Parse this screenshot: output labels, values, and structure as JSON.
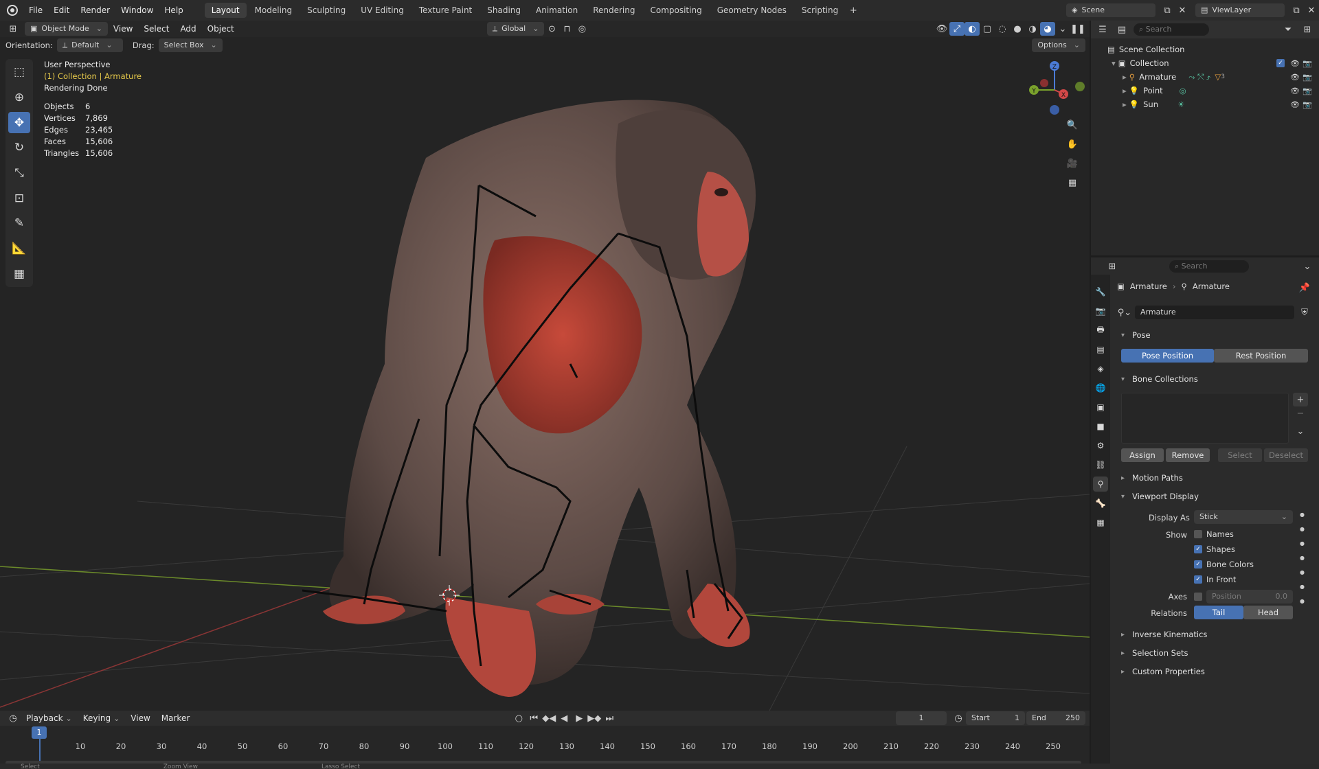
{
  "topbar": {
    "menus": [
      "File",
      "Edit",
      "Render",
      "Window",
      "Help"
    ],
    "workspaces": [
      "Layout",
      "Modeling",
      "Sculpting",
      "UV Editing",
      "Texture Paint",
      "Shading",
      "Animation",
      "Rendering",
      "Compositing",
      "Geometry Nodes",
      "Scripting"
    ],
    "active_workspace": "Layout",
    "scene": "Scene",
    "view_layer": "ViewLayer"
  },
  "viewport_header": {
    "mode": "Object Mode",
    "menus": [
      "View",
      "Select",
      "Add",
      "Object"
    ],
    "transform_orientation": "Global",
    "orientation_label": "Orientation:",
    "orientation_value": "Default",
    "drag_label": "Drag:",
    "drag_value": "Select Box",
    "options_label": "Options"
  },
  "overlay": {
    "view_name": "User Perspective",
    "collection_info": "(1) Collection | Armature",
    "status": "Rendering Done",
    "stats": [
      {
        "label": "Objects",
        "value": "6"
      },
      {
        "label": "Vertices",
        "value": "7,869"
      },
      {
        "label": "Edges",
        "value": "23,465"
      },
      {
        "label": "Faces",
        "value": "15,606"
      },
      {
        "label": "Triangles",
        "value": "15,606"
      }
    ]
  },
  "gizmo": {
    "z": "Z",
    "y": "Y",
    "x": "X"
  },
  "outliner": {
    "search_placeholder": "Search",
    "root": "Scene Collection",
    "collection": "Collection",
    "items": [
      {
        "name": "Armature",
        "extra": "3"
      },
      {
        "name": "Point"
      },
      {
        "name": "Sun"
      }
    ]
  },
  "properties": {
    "search_placeholder": "Search",
    "breadcrumb_object": "Armature",
    "breadcrumb_data": "Armature",
    "data_name": "Armature",
    "pose_section": "Pose",
    "pose_position": "Pose Position",
    "rest_position": "Rest Position",
    "bone_collections": "Bone Collections",
    "assign": "Assign",
    "remove": "Remove",
    "select": "Select",
    "deselect": "Deselect",
    "motion_paths": "Motion Paths",
    "viewport_display": "Viewport Display",
    "display_as_label": "Display As",
    "display_as_value": "Stick",
    "show_label": "Show",
    "names": "Names",
    "shapes": "Shapes",
    "bone_colors": "Bone Colors",
    "in_front": "In Front",
    "axes_label": "Axes",
    "axes_position_label": "Position",
    "axes_position_value": "0.0",
    "relations_label": "Relations",
    "tail": "Tail",
    "head": "Head",
    "inverse_kinematics": "Inverse Kinematics",
    "selection_sets": "Selection Sets",
    "custom_properties": "Custom Properties"
  },
  "timeline": {
    "menus": [
      "Playback",
      "Keying",
      "View",
      "Marker"
    ],
    "current_frame": "1",
    "start_label": "Start",
    "start_value": "1",
    "end_label": "End",
    "end_value": "250",
    "ticks": [
      "10",
      "20",
      "30",
      "40",
      "50",
      "60",
      "70",
      "80",
      "90",
      "100",
      "110",
      "120",
      "130",
      "140",
      "150",
      "160",
      "170",
      "180",
      "190",
      "200",
      "210",
      "220",
      "230",
      "240",
      "250"
    ]
  },
  "statusbar": {
    "select": "Select",
    "zoom": "Zoom View",
    "lasso": "Lasso Select"
  },
  "colors": {
    "accent": "#4772b3",
    "header_bg": "#2b2b2b",
    "viewport_bg": "#242424",
    "grid_red": "#8a3535",
    "grid_green": "#6b8a2a"
  }
}
